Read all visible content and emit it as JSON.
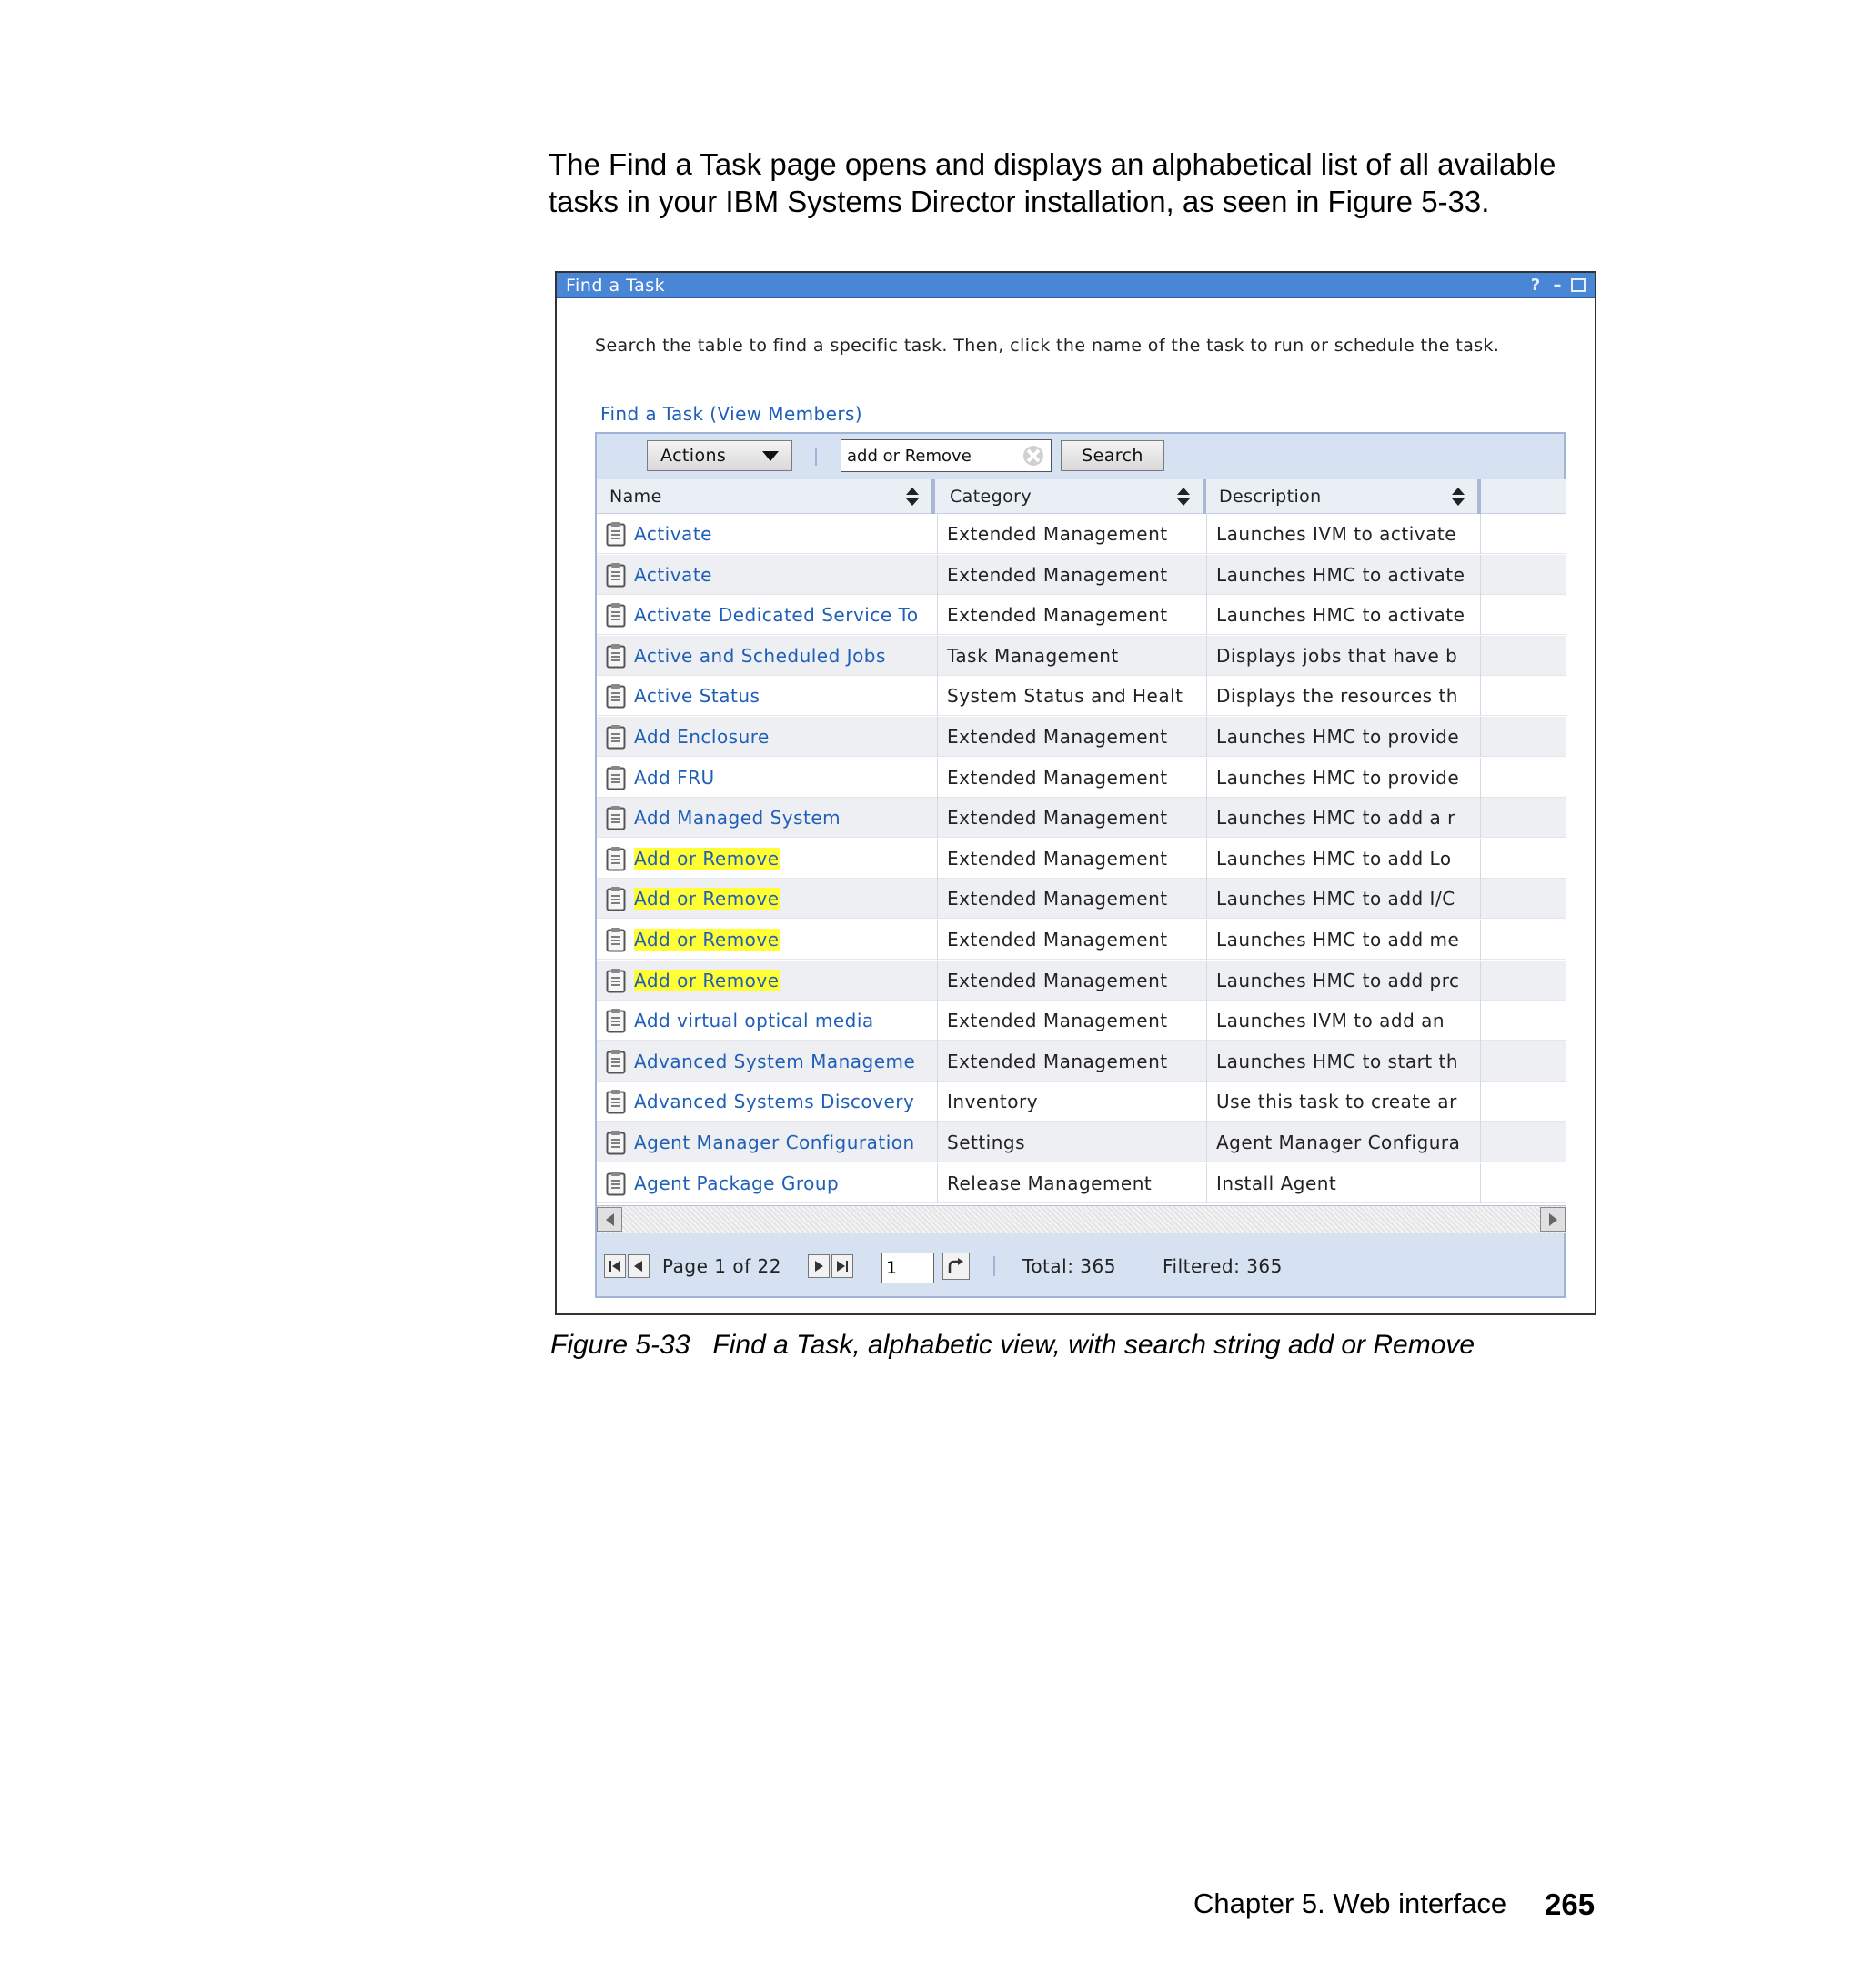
{
  "intro": "The Find a Task page opens and displays an alphabetical list of all available tasks in your IBM Systems Director installation, as seen in Figure 5-33.",
  "window": {
    "title": "Find a Task",
    "help_glyph": "?",
    "minimize_glyph": "–",
    "description": "Search the table to find a specific task. Then, click the name of the task to run or schedule the task.",
    "table_link": "Find a Task (View Members)"
  },
  "toolbar": {
    "actions_label": "Actions",
    "search_value": "add or Remove",
    "search_button": "Search"
  },
  "columns": {
    "name": "Name",
    "category": "Category",
    "description": "Description"
  },
  "rows": [
    {
      "name": "Activate",
      "category": "Extended Management",
      "description": "Launches IVM to activate",
      "highlight": false
    },
    {
      "name": "Activate",
      "category": "Extended Management",
      "description": "Launches HMC to activate",
      "highlight": false
    },
    {
      "name": "Activate Dedicated Service To",
      "category": "Extended Management",
      "description": "Launches HMC to activate",
      "highlight": false
    },
    {
      "name": "Active and Scheduled Jobs",
      "category": "Task Management",
      "description": "Displays jobs that have b",
      "highlight": false
    },
    {
      "name": "Active Status",
      "category": "System Status and Healt",
      "description": "Displays the resources th",
      "highlight": false
    },
    {
      "name": "Add Enclosure",
      "category": "Extended Management",
      "description": "Launches HMC to provide",
      "highlight": false
    },
    {
      "name": "Add FRU",
      "category": "Extended Management",
      "description": "Launches HMC to provide",
      "highlight": false
    },
    {
      "name": "Add Managed System",
      "category": "Extended Management",
      "description": "Launches HMC to add a r",
      "highlight": false
    },
    {
      "name": "Add or Remove",
      "category": "Extended Management",
      "description": "Launches HMC to add Lo",
      "highlight": true
    },
    {
      "name": "Add or Remove",
      "category": "Extended Management",
      "description": "Launches HMC to add I/C",
      "highlight": true
    },
    {
      "name": "Add or Remove",
      "category": "Extended Management",
      "description": "Launches HMC to add me",
      "highlight": true
    },
    {
      "name": "Add or Remove",
      "category": "Extended Management",
      "description": "Launches HMC to add prc",
      "highlight": true
    },
    {
      "name": "Add virtual optical media",
      "category": "Extended Management",
      "description": "Launches IVM to add an",
      "highlight": false
    },
    {
      "name": "Advanced System Manageme",
      "category": "Extended Management",
      "description": "Launches HMC to start th",
      "highlight": false
    },
    {
      "name": "Advanced Systems Discovery",
      "category": "Inventory",
      "description": "Use this task to create ar",
      "highlight": false
    },
    {
      "name": "Agent Manager Configuration",
      "category": "Settings",
      "description": "Agent Manager Configura",
      "highlight": false
    },
    {
      "name": "Agent Package Group",
      "category": "Release Management",
      "description": "Install Agent",
      "highlight": false
    }
  ],
  "pager": {
    "page_label": "Page 1 of 22",
    "page_input": "1",
    "total": "Total: 365",
    "filtered": "Filtered: 365"
  },
  "caption": "Figure 5-33   Find a Task, alphabetic view, with search string add or Remove",
  "footer": {
    "chapter": "Chapter 5. Web interface",
    "page_number": "265"
  },
  "colors": {
    "titlebar": "#4a86d6",
    "link": "#1f5fb8",
    "highlight": "#ffff33",
    "panel": "#d6e1f2"
  }
}
